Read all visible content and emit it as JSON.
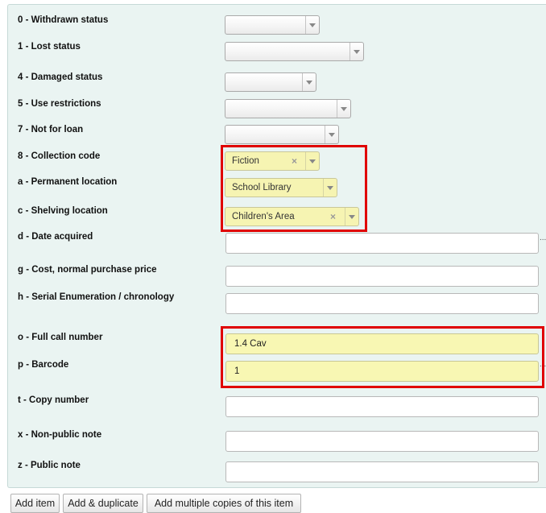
{
  "fields": {
    "withdrawn": {
      "label": "0 - Withdrawn status"
    },
    "lost": {
      "label": "1 - Lost status"
    },
    "damaged": {
      "label": "4 - Damaged status"
    },
    "restrictions": {
      "label": "5 - Use restrictions"
    },
    "notforloan": {
      "label": "7 - Not for loan"
    },
    "ccode": {
      "label": "8 - Collection code",
      "value": "Fiction"
    },
    "permanent_location": {
      "label": "a - Permanent location",
      "value": "School Library"
    },
    "shelving_location": {
      "label": "c - Shelving location",
      "value": "Children's Area"
    },
    "date_acquired": {
      "label": "d - Date acquired",
      "value": ""
    },
    "cost": {
      "label": "g - Cost, normal purchase price",
      "value": ""
    },
    "serial_enum": {
      "label": "h - Serial Enumeration / chronology",
      "value": ""
    },
    "call_number": {
      "label": "o - Full call number",
      "value": "1.4 Cav"
    },
    "barcode": {
      "label": "p - Barcode",
      "value": "1"
    },
    "copy_number": {
      "label": "t - Copy number",
      "value": ""
    },
    "nonpublic_note": {
      "label": "x - Non-public note",
      "value": ""
    },
    "public_note": {
      "label": "z - Public note",
      "value": ""
    }
  },
  "icons": {
    "clear": "×",
    "more": "..."
  },
  "actions": {
    "add_item": "Add item",
    "add_duplicate": "Add & duplicate",
    "add_multiple": "Add multiple copies of this item"
  },
  "colors": {
    "highlight_border": "#e00000",
    "field_highlight": "#f6f4b2",
    "panel_bg": "#eaf4f2"
  }
}
